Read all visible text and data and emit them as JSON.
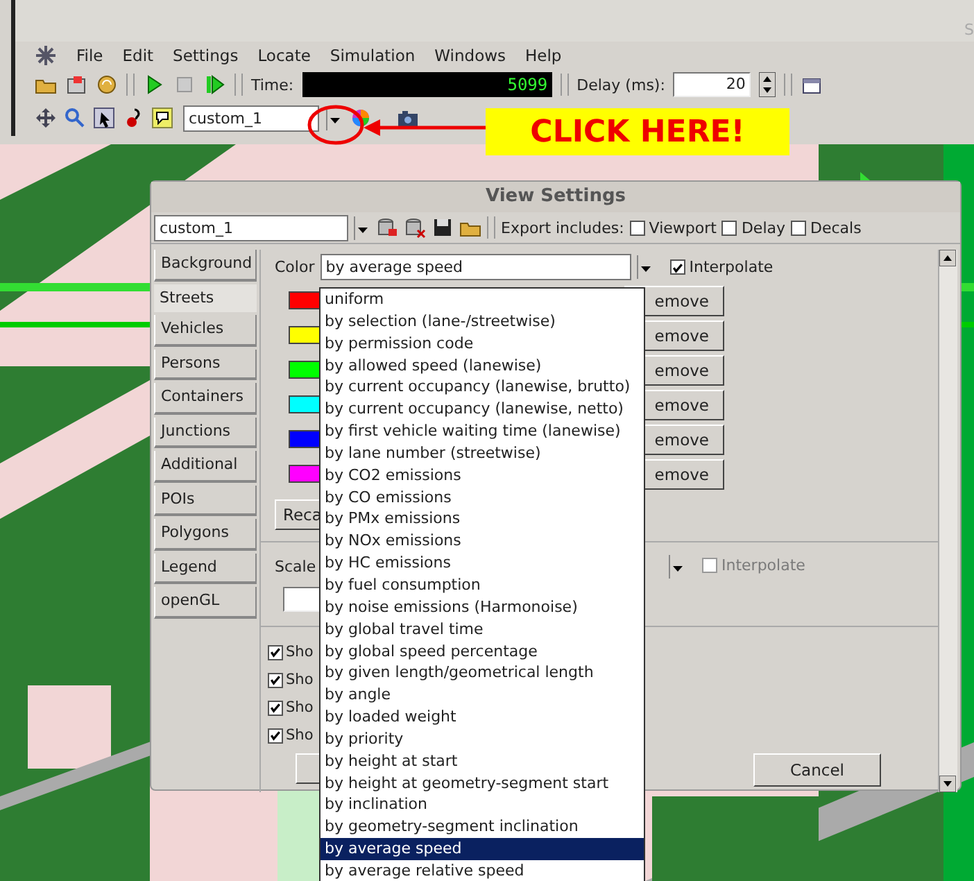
{
  "window": {
    "title": "S"
  },
  "menu": [
    "File",
    "Edit",
    "Settings",
    "Locate",
    "Simulation",
    "Windows",
    "Help"
  ],
  "toolbar": {
    "time_label": "Time:",
    "time": "5099",
    "delay_label": "Delay (ms):",
    "delay": "20"
  },
  "view_toolbar": {
    "scheme": "custom_1"
  },
  "callout": "CLICK HERE!",
  "dialog": {
    "title": "View Settings",
    "scheme": "custom_1",
    "export_label": "Export includes:",
    "export_options": [
      {
        "label": "Viewport",
        "checked": false
      },
      {
        "label": "Delay",
        "checked": false
      },
      {
        "label": "Decals",
        "checked": false
      }
    ],
    "tabs": [
      {
        "label": "Background",
        "selected": false
      },
      {
        "label": "Streets",
        "selected": true
      },
      {
        "label": "Vehicles",
        "selected": false
      },
      {
        "label": "Persons",
        "selected": false
      },
      {
        "label": "Containers",
        "selected": false
      },
      {
        "label": "Junctions",
        "selected": false
      },
      {
        "label": "Additional",
        "selected": false
      },
      {
        "label": "POIs",
        "selected": false
      },
      {
        "label": "Polygons",
        "selected": false
      },
      {
        "label": "Legend",
        "selected": false
      },
      {
        "label": "openGL",
        "selected": false
      }
    ],
    "color_label": "Color",
    "color_value": "by average speed",
    "interpolate": {
      "label": "Interpolate",
      "checked": true
    },
    "color_rows": [
      {
        "color": "#ff0000",
        "button": "emove"
      },
      {
        "color": "#ffff00",
        "button": "emove"
      },
      {
        "color": "#00ff00",
        "button": "emove"
      },
      {
        "color": "#00ffff",
        "button": "emove"
      },
      {
        "color": "#0000ff",
        "button": "emove"
      },
      {
        "color": "#ff00ff",
        "button": "emove"
      }
    ],
    "recalibrate": "Reca",
    "scale_label": "Scale",
    "scale_interpolate": {
      "label": "Interpolate",
      "checked": false,
      "disabled": true
    },
    "show_options": [
      {
        "label": "Sho",
        "checked": true
      },
      {
        "label": "Sho",
        "checked": true
      },
      {
        "label": "Sho",
        "checked": true
      },
      {
        "label": "Sho",
        "checked": true
      }
    ],
    "cancel": "Cancel"
  },
  "dropdown": {
    "items": [
      {
        "label": "uniform",
        "selected": false
      },
      {
        "label": "by selection (lane-/streetwise)",
        "selected": false
      },
      {
        "label": "by permission code",
        "selected": false
      },
      {
        "label": "by allowed speed (lanewise)",
        "selected": false
      },
      {
        "label": "by current occupancy (lanewise, brutto)",
        "selected": false
      },
      {
        "label": "by current occupancy (lanewise, netto)",
        "selected": false
      },
      {
        "label": "by first vehicle waiting time (lanewise)",
        "selected": false
      },
      {
        "label": "by lane number (streetwise)",
        "selected": false
      },
      {
        "label": "by CO2 emissions",
        "selected": false
      },
      {
        "label": "by CO emissions",
        "selected": false
      },
      {
        "label": "by PMx emissions",
        "selected": false
      },
      {
        "label": "by NOx emissions",
        "selected": false
      },
      {
        "label": "by HC emissions",
        "selected": false
      },
      {
        "label": "by fuel consumption",
        "selected": false
      },
      {
        "label": "by noise emissions (Harmonoise)",
        "selected": false
      },
      {
        "label": "by global travel time",
        "selected": false
      },
      {
        "label": "by global speed percentage",
        "selected": false
      },
      {
        "label": "by given length/geometrical length",
        "selected": false
      },
      {
        "label": "by angle",
        "selected": false
      },
      {
        "label": "by loaded weight",
        "selected": false
      },
      {
        "label": "by priority",
        "selected": false
      },
      {
        "label": "by height at start",
        "selected": false
      },
      {
        "label": "by height at geometry-segment start",
        "selected": false
      },
      {
        "label": "by inclination",
        "selected": false
      },
      {
        "label": "by geometry-segment inclination",
        "selected": false
      },
      {
        "label": "by average speed",
        "selected": true
      },
      {
        "label": "by average relative speed",
        "selected": false
      }
    ]
  }
}
